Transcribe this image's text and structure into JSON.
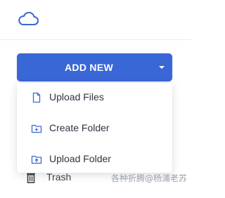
{
  "colors": {
    "accent": "#3a67d6",
    "icon_blue": "#3a67d6",
    "text": "#2e3440",
    "watermark": "#9aa0a8"
  },
  "logo": {
    "icon": "cloud-icon"
  },
  "add_new": {
    "label": "ADD NEW",
    "icon": "caret-down-icon"
  },
  "menu": {
    "items": [
      {
        "label": "Upload Files",
        "icon": "file-icon"
      },
      {
        "label": "Create Folder",
        "icon": "folder-plus-icon"
      },
      {
        "label": "Upload Folder",
        "icon": "folder-upload-icon"
      }
    ]
  },
  "sidebar": {
    "trash": {
      "label": "Trash",
      "icon": "trash-icon"
    }
  },
  "watermark": {
    "text": "各种折腾@杨浦老苏"
  }
}
